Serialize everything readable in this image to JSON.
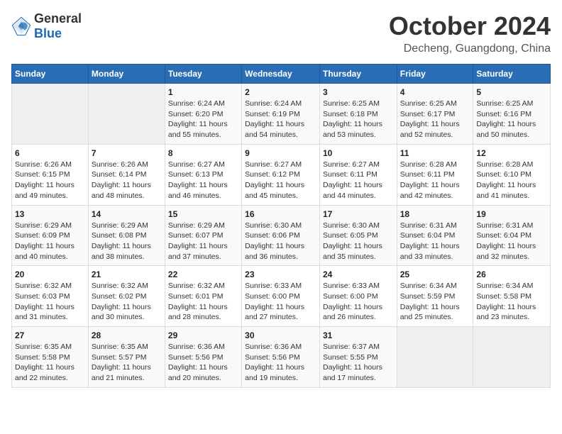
{
  "header": {
    "logo_general": "General",
    "logo_blue": "Blue",
    "month": "October 2024",
    "location": "Decheng, Guangdong, China"
  },
  "calendar": {
    "days_of_week": [
      "Sunday",
      "Monday",
      "Tuesday",
      "Wednesday",
      "Thursday",
      "Friday",
      "Saturday"
    ],
    "weeks": [
      [
        {
          "day": "",
          "info": ""
        },
        {
          "day": "",
          "info": ""
        },
        {
          "day": "1",
          "info": "Sunrise: 6:24 AM\nSunset: 6:20 PM\nDaylight: 11 hours and 55 minutes."
        },
        {
          "day": "2",
          "info": "Sunrise: 6:24 AM\nSunset: 6:19 PM\nDaylight: 11 hours and 54 minutes."
        },
        {
          "day": "3",
          "info": "Sunrise: 6:25 AM\nSunset: 6:18 PM\nDaylight: 11 hours and 53 minutes."
        },
        {
          "day": "4",
          "info": "Sunrise: 6:25 AM\nSunset: 6:17 PM\nDaylight: 11 hours and 52 minutes."
        },
        {
          "day": "5",
          "info": "Sunrise: 6:25 AM\nSunset: 6:16 PM\nDaylight: 11 hours and 50 minutes."
        }
      ],
      [
        {
          "day": "6",
          "info": "Sunrise: 6:26 AM\nSunset: 6:15 PM\nDaylight: 11 hours and 49 minutes."
        },
        {
          "day": "7",
          "info": "Sunrise: 6:26 AM\nSunset: 6:14 PM\nDaylight: 11 hours and 48 minutes."
        },
        {
          "day": "8",
          "info": "Sunrise: 6:27 AM\nSunset: 6:13 PM\nDaylight: 11 hours and 46 minutes."
        },
        {
          "day": "9",
          "info": "Sunrise: 6:27 AM\nSunset: 6:12 PM\nDaylight: 11 hours and 45 minutes."
        },
        {
          "day": "10",
          "info": "Sunrise: 6:27 AM\nSunset: 6:11 PM\nDaylight: 11 hours and 44 minutes."
        },
        {
          "day": "11",
          "info": "Sunrise: 6:28 AM\nSunset: 6:11 PM\nDaylight: 11 hours and 42 minutes."
        },
        {
          "day": "12",
          "info": "Sunrise: 6:28 AM\nSunset: 6:10 PM\nDaylight: 11 hours and 41 minutes."
        }
      ],
      [
        {
          "day": "13",
          "info": "Sunrise: 6:29 AM\nSunset: 6:09 PM\nDaylight: 11 hours and 40 minutes."
        },
        {
          "day": "14",
          "info": "Sunrise: 6:29 AM\nSunset: 6:08 PM\nDaylight: 11 hours and 38 minutes."
        },
        {
          "day": "15",
          "info": "Sunrise: 6:29 AM\nSunset: 6:07 PM\nDaylight: 11 hours and 37 minutes."
        },
        {
          "day": "16",
          "info": "Sunrise: 6:30 AM\nSunset: 6:06 PM\nDaylight: 11 hours and 36 minutes."
        },
        {
          "day": "17",
          "info": "Sunrise: 6:30 AM\nSunset: 6:05 PM\nDaylight: 11 hours and 35 minutes."
        },
        {
          "day": "18",
          "info": "Sunrise: 6:31 AM\nSunset: 6:04 PM\nDaylight: 11 hours and 33 minutes."
        },
        {
          "day": "19",
          "info": "Sunrise: 6:31 AM\nSunset: 6:04 PM\nDaylight: 11 hours and 32 minutes."
        }
      ],
      [
        {
          "day": "20",
          "info": "Sunrise: 6:32 AM\nSunset: 6:03 PM\nDaylight: 11 hours and 31 minutes."
        },
        {
          "day": "21",
          "info": "Sunrise: 6:32 AM\nSunset: 6:02 PM\nDaylight: 11 hours and 30 minutes."
        },
        {
          "day": "22",
          "info": "Sunrise: 6:32 AM\nSunset: 6:01 PM\nDaylight: 11 hours and 28 minutes."
        },
        {
          "day": "23",
          "info": "Sunrise: 6:33 AM\nSunset: 6:00 PM\nDaylight: 11 hours and 27 minutes."
        },
        {
          "day": "24",
          "info": "Sunrise: 6:33 AM\nSunset: 6:00 PM\nDaylight: 11 hours and 26 minutes."
        },
        {
          "day": "25",
          "info": "Sunrise: 6:34 AM\nSunset: 5:59 PM\nDaylight: 11 hours and 25 minutes."
        },
        {
          "day": "26",
          "info": "Sunrise: 6:34 AM\nSunset: 5:58 PM\nDaylight: 11 hours and 23 minutes."
        }
      ],
      [
        {
          "day": "27",
          "info": "Sunrise: 6:35 AM\nSunset: 5:58 PM\nDaylight: 11 hours and 22 minutes."
        },
        {
          "day": "28",
          "info": "Sunrise: 6:35 AM\nSunset: 5:57 PM\nDaylight: 11 hours and 21 minutes."
        },
        {
          "day": "29",
          "info": "Sunrise: 6:36 AM\nSunset: 5:56 PM\nDaylight: 11 hours and 20 minutes."
        },
        {
          "day": "30",
          "info": "Sunrise: 6:36 AM\nSunset: 5:56 PM\nDaylight: 11 hours and 19 minutes."
        },
        {
          "day": "31",
          "info": "Sunrise: 6:37 AM\nSunset: 5:55 PM\nDaylight: 11 hours and 17 minutes."
        },
        {
          "day": "",
          "info": ""
        },
        {
          "day": "",
          "info": ""
        }
      ]
    ]
  }
}
